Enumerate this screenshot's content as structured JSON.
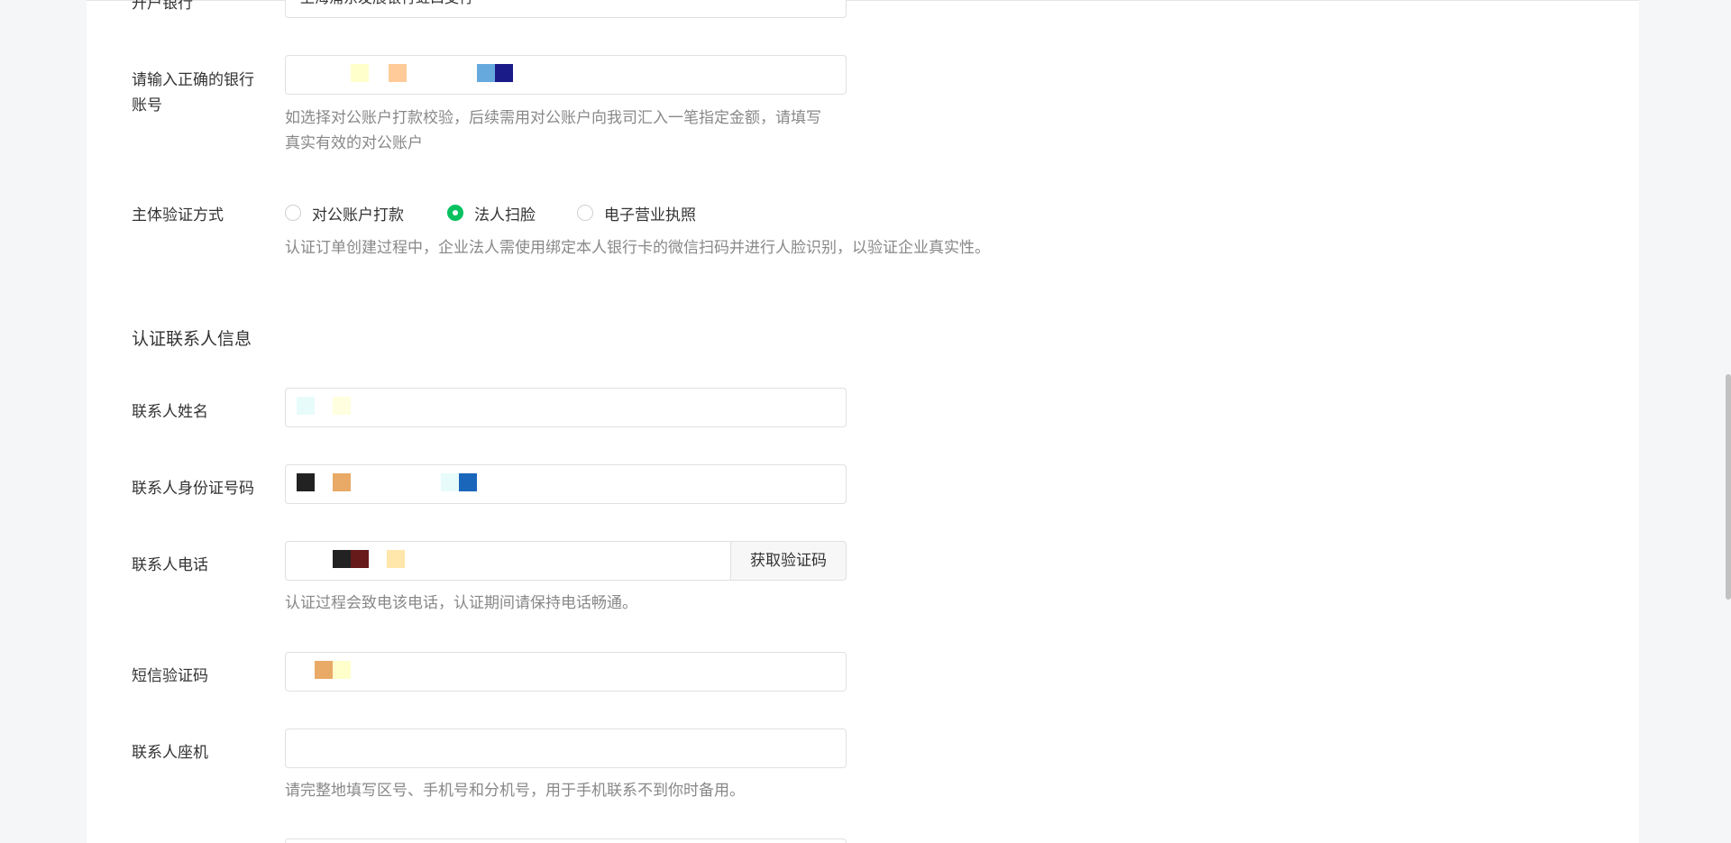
{
  "form": {
    "bank_branch": {
      "label": "开户银行",
      "value": "上海浦东发展银行虹口支行"
    },
    "account_number": {
      "label_line1": "请输入正确的银行",
      "label_line2": "账号",
      "hint_line1": "如选择对公账户打款校验，后续需用对公账户向我司汇入一笔指定金额，请填写",
      "hint_line2": "真实有效的对公账户"
    },
    "verify_method": {
      "label": "主体验证方式",
      "options": [
        "对公账户打款",
        "法人扫脸",
        "电子营业执照"
      ],
      "selected": "法人扫脸",
      "hint": "认证订单创建过程中，企业法人需使用绑定本人银行卡的微信扫码并进行人脸识别，以验证企业真实性。"
    },
    "contact_section_title": "认证联系人信息",
    "contact_name": {
      "label": "联系人姓名"
    },
    "contact_id": {
      "label": "联系人身份证号码"
    },
    "contact_phone": {
      "label": "联系人电话",
      "button": "获取验证码",
      "hint": "认证过程会致电该电话，认证期间请保持电话畅通。"
    },
    "sms_code": {
      "label": "短信验证码"
    },
    "contact_landline": {
      "label": "联系人座机",
      "hint": "请完整地填写区号、手机号和分机号，用于手机联系不到你时备用。"
    }
  },
  "colors": {
    "accent": "#07c160",
    "page_bg": "#f5f6f7",
    "panel_bg": "#ffffff",
    "border": "#e0e0e0",
    "hint_text": "#888888"
  }
}
